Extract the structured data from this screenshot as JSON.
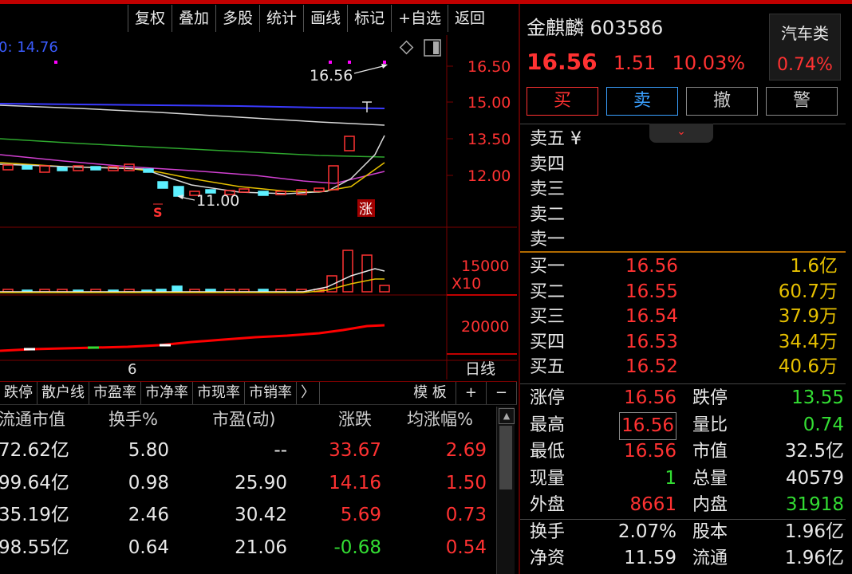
{
  "toolbar": {
    "buttons": [
      "复权",
      "叠加",
      "多股",
      "统计",
      "画线",
      "标记",
      "+自选",
      "返回"
    ]
  },
  "chart": {
    "ma_label": "0: 14.76",
    "price_ticks": [
      "16.50",
      "15.00",
      "13.50",
      "12.00"
    ],
    "volume_tick": "15000",
    "volume_unit": "X10",
    "indicator_tick": "20000",
    "high_annotation": "16.56",
    "low_annotation": "11.00",
    "limit_up_marker": "涨",
    "s_marker": "S",
    "date_label": "6",
    "period_label": "日线",
    "colors": {
      "up": "#ff3232",
      "down": "#5cf0ff",
      "ma_blue": "#3a3aff",
      "ma_white": "#dddddd",
      "ma_green": "#2ea82e",
      "ma_magenta": "#d040d0",
      "ma_yellow": "#e6c000",
      "grid": "#7a0000"
    }
  },
  "tabs": {
    "items": [
      "跌停",
      "散户线",
      "市盈率",
      "市净率",
      "市现率",
      "市销率",
      "〉"
    ],
    "right": [
      "模 板",
      "+",
      "−"
    ]
  },
  "table": {
    "headers": [
      "流通市值",
      "换手%",
      "市盈(动)",
      "涨跌",
      "均涨幅%"
    ],
    "rows": [
      {
        "cap": "72.62亿",
        "turnover": "5.80",
        "pe": "--",
        "chg": "33.67",
        "chg_dir": "up",
        "avg": "2.69",
        "avg_dir": "up"
      },
      {
        "cap": "99.64亿",
        "turnover": "0.98",
        "pe": "25.90",
        "chg": "14.16",
        "chg_dir": "up",
        "avg": "1.50",
        "avg_dir": "up"
      },
      {
        "cap": "35.19亿",
        "turnover": "2.46",
        "pe": "30.42",
        "chg": "5.69",
        "chg_dir": "up",
        "avg": "0.73",
        "avg_dir": "up"
      },
      {
        "cap": "98.55亿",
        "turnover": "0.64",
        "pe": "21.06",
        "chg": "-0.68",
        "chg_dir": "down",
        "avg": "0.54",
        "avg_dir": "up"
      }
    ]
  },
  "panel": {
    "name": "金麒麟",
    "code": "603586",
    "price": "16.56",
    "change": "1.51",
    "change_pct": "10.03%",
    "sector_name": "汽车类",
    "sector_pct": "0.74%",
    "trade_buttons": [
      "买",
      "卖",
      "撤",
      "警"
    ],
    "asks": [
      {
        "label": "卖五 ¥",
        "price": "",
        "vol": ""
      },
      {
        "label": "卖四",
        "price": "",
        "vol": ""
      },
      {
        "label": "卖三",
        "price": "",
        "vol": ""
      },
      {
        "label": "卖二",
        "price": "",
        "vol": ""
      },
      {
        "label": "卖一",
        "price": "",
        "vol": ""
      }
    ],
    "bids": [
      {
        "label": "买一",
        "price": "16.56",
        "vol": "1.6亿"
      },
      {
        "label": "买二",
        "price": "16.55",
        "vol": "60.7万"
      },
      {
        "label": "买三",
        "price": "16.54",
        "vol": "37.9万"
      },
      {
        "label": "买四",
        "price": "16.53",
        "vol": "34.4万"
      },
      {
        "label": "买五",
        "price": "16.52",
        "vol": "40.6万"
      }
    ],
    "stats": [
      {
        "l": "涨停",
        "v": "16.56",
        "vc": "#ff3232",
        "l2": "跌停",
        "v2": "13.55",
        "v2c": "#33dd33"
      },
      {
        "l": "最高",
        "v": "16.56",
        "vc": "#ff3232",
        "l2": "量比",
        "v2": "0.74",
        "v2c": "#33dd33",
        "boxed": true
      },
      {
        "l": "最低",
        "v": "16.56",
        "vc": "#ff3232",
        "l2": "市值",
        "v2": "32.5亿",
        "v2c": "#e8e8e8"
      },
      {
        "l": "现量",
        "v": "1",
        "vc": "#33dd33",
        "l2": "总量",
        "v2": "40579",
        "v2c": "#e8e8e8"
      },
      {
        "l": "外盘",
        "v": "8661",
        "vc": "#ff3232",
        "l2": "内盘",
        "v2": "31918",
        "v2c": "#33dd33"
      },
      {
        "l": "换手",
        "v": "2.07%",
        "vc": "#e8e8e8",
        "l2": "股本",
        "v2": "1.96亿",
        "v2c": "#e8e8e8"
      },
      {
        "l": "净资",
        "v": "11.59",
        "vc": "#e8e8e8",
        "l2": "流通",
        "v2": "1.96亿",
        "v2c": "#e8e8e8"
      }
    ]
  }
}
